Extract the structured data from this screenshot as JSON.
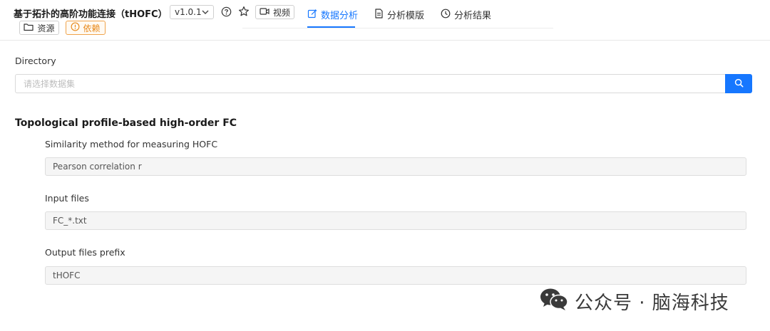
{
  "header": {
    "title": "基于拓扑的高阶功能连接（tHOFC）",
    "version": "v1.0.1",
    "video_label": "视频",
    "resources_label": "资源",
    "dependencies_label": "依赖"
  },
  "tabs": [
    {
      "label": "数据分析",
      "active": true,
      "icon": "edit-icon"
    },
    {
      "label": "分析模版",
      "active": false,
      "icon": "document-icon"
    },
    {
      "label": "分析结果",
      "active": false,
      "icon": "clock-icon"
    }
  ],
  "directory": {
    "label": "Directory",
    "placeholder": "请选择数据集"
  },
  "section": {
    "title": "Topological profile-based high-order FC",
    "fields": [
      {
        "label": "Similarity method for measuring HOFC",
        "value": "Pearson correlation r"
      },
      {
        "label": "Input files",
        "value": "FC_*.txt"
      },
      {
        "label": "Output files prefix",
        "value": "tHOFC"
      }
    ]
  },
  "watermark": {
    "text": "公众号 · 脑海科技",
    "icon": "wechat-icon"
  },
  "colors": {
    "primary": "#1677ff",
    "warning": "#e8891a"
  }
}
